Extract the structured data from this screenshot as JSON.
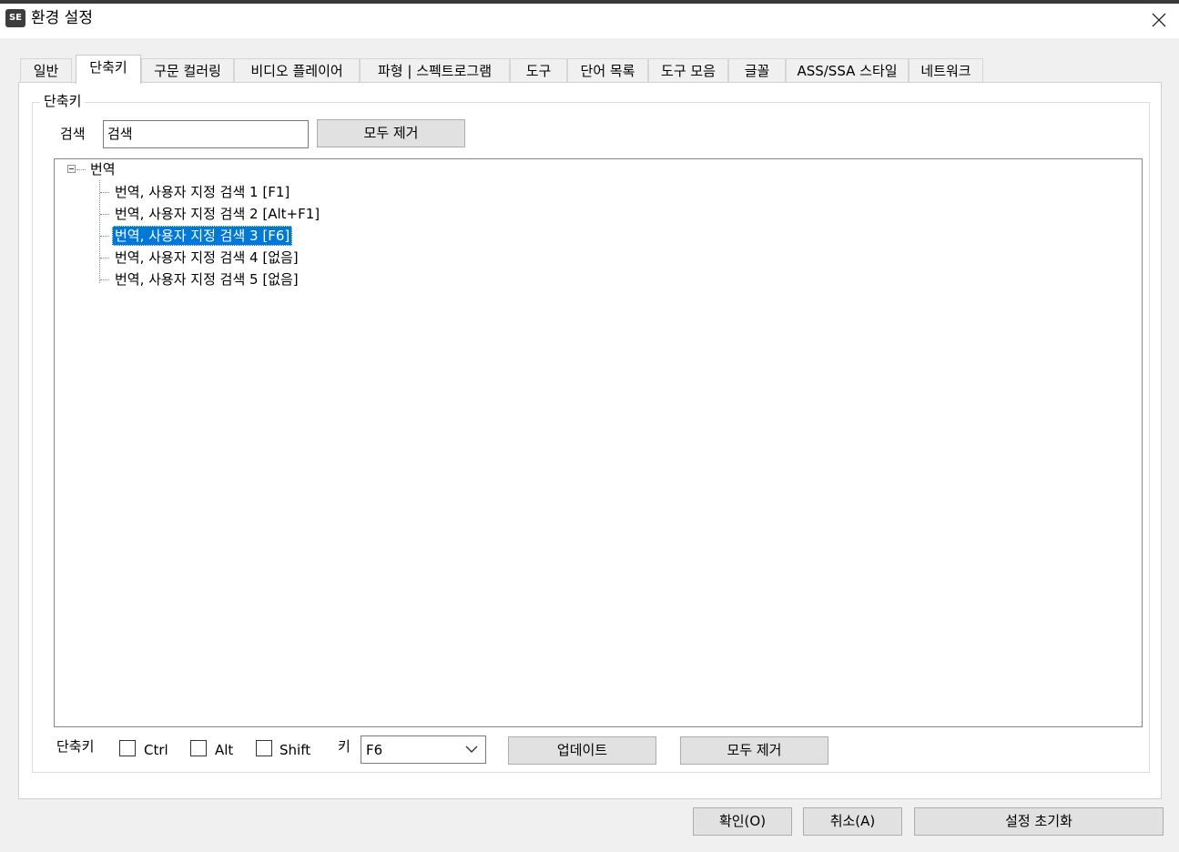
{
  "window": {
    "app_icon_text": "SE",
    "title": "환경 설정"
  },
  "tabs": [
    {
      "label": "일반"
    },
    {
      "label": "단축키",
      "active": true
    },
    {
      "label": "구문 컬러링"
    },
    {
      "label": "비디오 플레이어"
    },
    {
      "label": "파형 | 스펙트로그램"
    },
    {
      "label": "도구"
    },
    {
      "label": "단어 목록"
    },
    {
      "label": "도구 모음"
    },
    {
      "label": "글꼴"
    },
    {
      "label": "ASS/SSA 스타일"
    },
    {
      "label": "네트워크"
    }
  ],
  "shortcuts": {
    "group_title": "단축키",
    "search_label": "검색",
    "search_value": "검색",
    "clear_all_label": "모두 제거",
    "tree": {
      "root": "번역",
      "items": [
        {
          "label": "번역, 사용자 지정 검색 1 [F1]"
        },
        {
          "label": "번역, 사용자 지정 검색 2 [Alt+F1]"
        },
        {
          "label": "번역, 사용자 지정 검색 3 [F6]",
          "selected": true
        },
        {
          "label": "번역, 사용자 지정 검색 4 [없음]"
        },
        {
          "label": "번역, 사용자 지정 검색 5 [없음]"
        }
      ]
    },
    "bottom": {
      "shortcut_label": "단축키",
      "ctrl_label": "Ctrl",
      "alt_label": "Alt",
      "shift_label": "Shift",
      "key_label": "키",
      "key_value": "F6",
      "update_label": "업데이트",
      "clear_all_label": "모두 제거"
    }
  },
  "footer": {
    "ok_label": "확인(O)",
    "cancel_label": "취소(A)",
    "reset_label": "설정 초기화"
  }
}
